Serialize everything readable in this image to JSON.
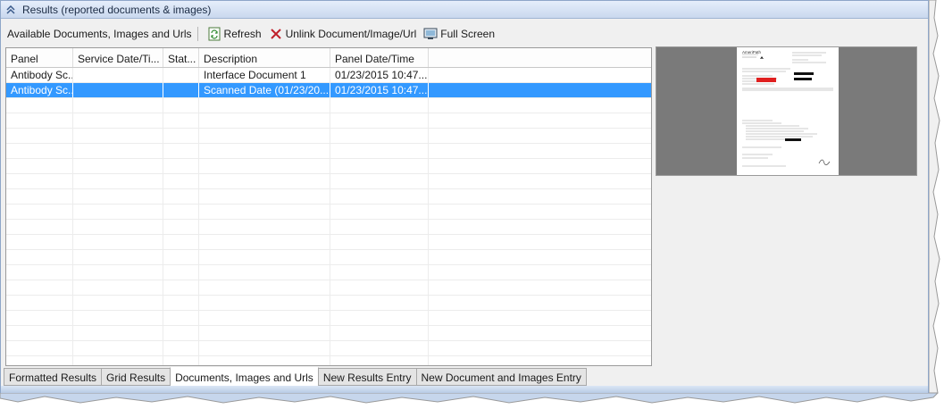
{
  "titlebar": {
    "title": "Results (reported documents & images)",
    "collapse_icon": "double-chevron-up-icon"
  },
  "toolbar": {
    "label": "Available Documents, Images and Urls",
    "refresh": "Refresh",
    "unlink": "Unlink Document/Image/Url",
    "fullscreen": "Full Screen"
  },
  "grid": {
    "columns": [
      "Panel",
      "Service Date/Ti...",
      "Stat...",
      "Description",
      "Panel Date/Time",
      ""
    ],
    "rows": [
      [
        "Antibody Sc...",
        "",
        "",
        "Interface Document 1",
        "01/23/2015 10:47...",
        ""
      ],
      [
        "Antibody Sc...",
        "",
        "",
        "Scanned Date (01/23/20...",
        "01/23/2015 10:47...",
        ""
      ]
    ],
    "selected_row": 1
  },
  "tabs": [
    "Formatted Results",
    "Grid Results",
    "Documents, Images and Urls",
    "New Results Entry",
    "New Document and Images Entry"
  ],
  "active_tab": 2,
  "colors": {
    "selection": "#3399ff",
    "title_bg": "#c9d8ee",
    "preview_bg": "#7a7a7a"
  }
}
